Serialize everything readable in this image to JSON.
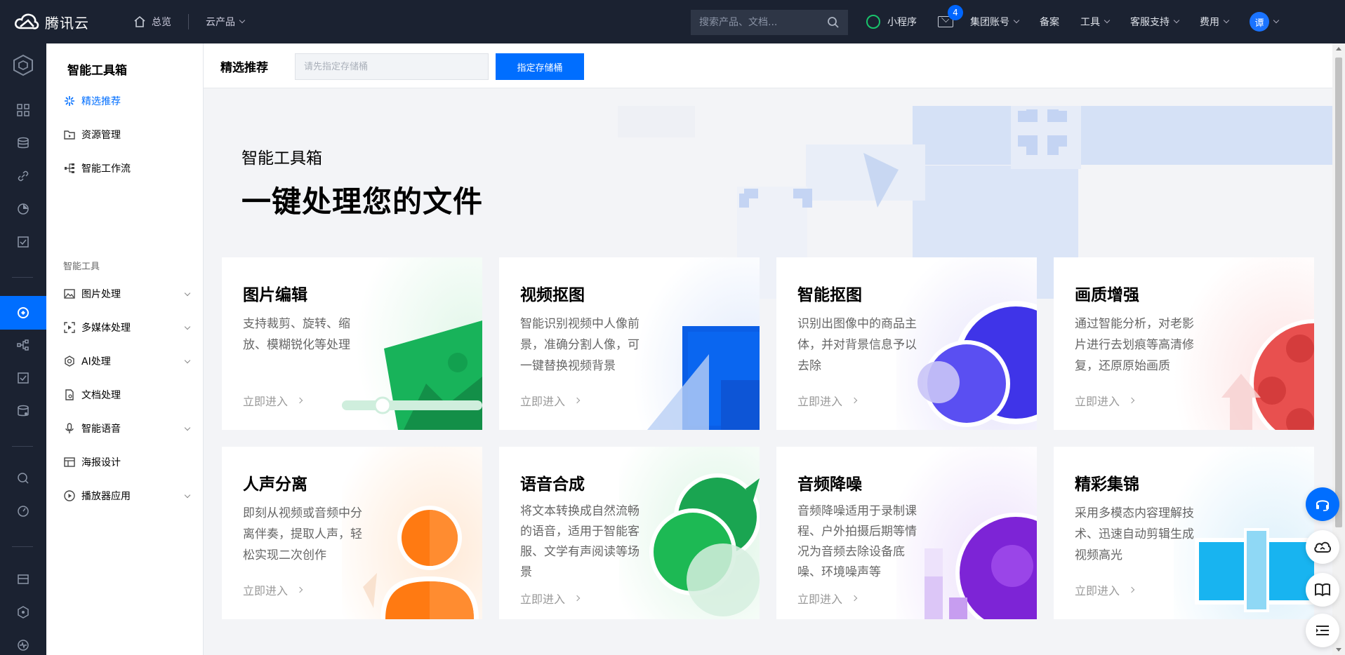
{
  "topbar": {
    "brand": "腾讯云",
    "home_label": "总览",
    "products_label": "云产品",
    "search_placeholder": "搜索产品、文档...",
    "miniprogram_label": "小程序",
    "mail_count": "4",
    "group_account_label": "集团账号",
    "filing_label": "备案",
    "tools_label": "工具",
    "support_label": "客服支持",
    "billing_label": "费用",
    "avatar_initial": "谭"
  },
  "sidebar": {
    "title": "智能工具箱",
    "items": [
      {
        "label": "精选推荐",
        "icon": "sparkle-icon"
      },
      {
        "label": "资源管理",
        "icon": "folder-icon"
      },
      {
        "label": "智能工作流",
        "icon": "workflow-icon"
      }
    ],
    "group_label": "智能工具",
    "tools": [
      {
        "label": "图片处理",
        "icon": "image-icon",
        "expandable": true
      },
      {
        "label": "多媒体处理",
        "icon": "media-icon",
        "expandable": true
      },
      {
        "label": "AI处理",
        "icon": "ai-icon",
        "expandable": true
      },
      {
        "label": "文档处理",
        "icon": "document-icon",
        "expandable": false
      },
      {
        "label": "智能语音",
        "icon": "microphone-icon",
        "expandable": true
      },
      {
        "label": "海报设计",
        "icon": "poster-icon",
        "expandable": false
      },
      {
        "label": "播放器应用",
        "icon": "play-icon",
        "expandable": true
      }
    ]
  },
  "header": {
    "title": "精选推荐",
    "bucket_placeholder": "请先指定存储桶",
    "bucket_button": "指定存储桶"
  },
  "hero": {
    "subtitle": "智能工具箱",
    "title": "一键处理您的文件"
  },
  "cards": [
    {
      "title": "图片编辑",
      "desc": "支持裁剪、旋转、缩放、模糊锐化等处理",
      "link": "立即进入",
      "accent": "#18b35a"
    },
    {
      "title": "视频抠图",
      "desc": "智能识别视频中人像前景，准确分割人像，可一键替换视频背景",
      "link": "立即进入",
      "accent": "#0a5ee6"
    },
    {
      "title": "智能抠图",
      "desc": "识别出图像中的商品主体，并对背景信息予以去除",
      "link": "立即进入",
      "accent": "#4b3ff0"
    },
    {
      "title": "画质增强",
      "desc": "通过智能分析，对老影片进行去划痕等高清修复，还原原始画质",
      "link": "立即进入",
      "accent": "#e8504f"
    },
    {
      "title": "人声分离",
      "desc": "即刻从视频或音频中分离伴奏，提取人声，轻松实现二次创作",
      "link": "立即进入",
      "accent": "#ff7a12"
    },
    {
      "title": "语音合成",
      "desc": "将文本转换成自然流畅的语音，适用于智能客服、文学有声阅读等场景",
      "link": "立即进入",
      "accent": "#1db954"
    },
    {
      "title": "音频降噪",
      "desc": "音频降噪适用于录制课程、户外拍摄后期等情况为音频去除设备底噪、环境噪声等",
      "link": "立即进入",
      "accent": "#8a28e0"
    },
    {
      "title": "精彩集锦",
      "desc": "采用多模态内容理解技术、迅速自动剪辑生成视频高光",
      "link": "立即进入",
      "accent": "#18b4f0"
    }
  ],
  "colors": {
    "topbar_bg": "#1b2231",
    "primary": "#006eff",
    "page_bg": "#f3f4f7"
  }
}
